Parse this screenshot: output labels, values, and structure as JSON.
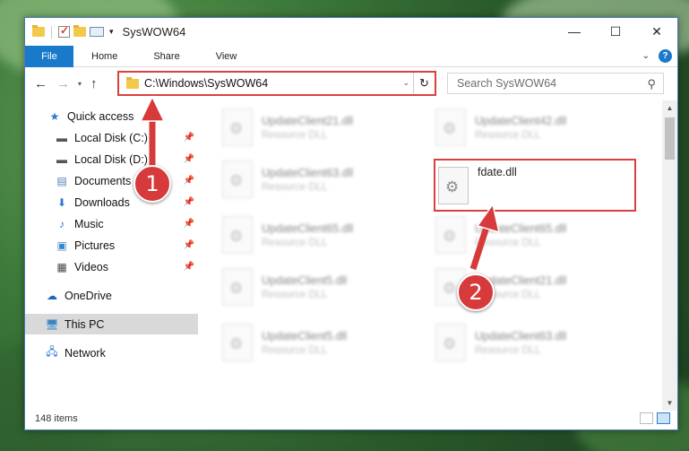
{
  "window": {
    "title": "SysWOW64",
    "controls": {
      "minimize": "—",
      "maximize": "☐",
      "close": "✕"
    }
  },
  "ribbon": {
    "tabs": [
      "File",
      "Home",
      "Share",
      "View"
    ],
    "help": "?"
  },
  "navigation": {
    "address": "C:\\Windows\\SysWOW64",
    "search_placeholder": "Search SysWOW64"
  },
  "sidebar": {
    "items": [
      {
        "label": "Quick access",
        "icon": "star-icon"
      },
      {
        "label": "Local Disk (C:)",
        "icon": "drive-icon"
      },
      {
        "label": "Local Disk (D:)",
        "icon": "drive-icon"
      },
      {
        "label": "Documents",
        "icon": "documents-icon"
      },
      {
        "label": "Downloads",
        "icon": "download-icon"
      },
      {
        "label": "Music",
        "icon": "music-icon"
      },
      {
        "label": "Pictures",
        "icon": "pictures-icon"
      },
      {
        "label": "Videos",
        "icon": "videos-icon"
      },
      {
        "label": "OneDrive",
        "icon": "cloud-icon"
      },
      {
        "label": "This PC",
        "icon": "pc-icon"
      },
      {
        "label": "Network",
        "icon": "network-icon"
      }
    ]
  },
  "files": [
    {
      "name": "UpdateClient21.dll",
      "type": "Resource DLL"
    },
    {
      "name": "UpdateClient42.dll",
      "type": "Resource DLL"
    },
    {
      "name": "UpdateClient63.dll",
      "type": "Resource DLL"
    },
    {
      "name": "fdate.dll",
      "type": ""
    },
    {
      "name": "UpdateClient65.dll",
      "type": "Resource DLL"
    },
    {
      "name": "UpdateClient65.dll",
      "type": "Resource DLL"
    },
    {
      "name": "UpdateClient5.dll",
      "type": "Resource DLL"
    },
    {
      "name": "UpdateClient21.dll",
      "type": "Resource DLL"
    },
    {
      "name": "UpdateClient5.dll",
      "type": "Resource DLL"
    },
    {
      "name": "UpdateClient63.dll",
      "type": "Resource DLL"
    }
  ],
  "status": {
    "item_count": "148 items"
  },
  "annotations": {
    "step1": "1",
    "step2": "2"
  },
  "colors": {
    "accent": "#1979ca",
    "highlight": "#d94040"
  }
}
